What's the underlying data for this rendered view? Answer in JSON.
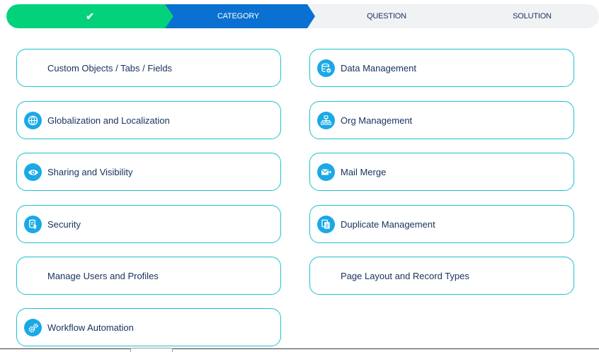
{
  "progress": {
    "completed_mark": "✔",
    "steps": [
      "CATEGORY",
      "QUESTION",
      "SOLUTION"
    ],
    "active_step": "CATEGORY",
    "colors": {
      "done": "#04d27b",
      "active": "#0a70d1",
      "pending": "#f1f2f4"
    }
  },
  "categories": [
    {
      "label": "Custom Objects / Tabs / Fields",
      "icon": ""
    },
    {
      "label": "Data Management",
      "icon": "database-check-icon"
    },
    {
      "label": "Globalization and Localization",
      "icon": "globe-icon"
    },
    {
      "label": "Org Management",
      "icon": "hierarchy-icon"
    },
    {
      "label": "Sharing and Visibility",
      "icon": "eye-icon"
    },
    {
      "label": "Mail Merge",
      "icon": "envelope-icon"
    },
    {
      "label": "Security",
      "icon": "shield-document-icon"
    },
    {
      "label": "Duplicate Management",
      "icon": "duplicate-docs-icon"
    },
    {
      "label": "Manage Users and Profiles",
      "icon": ""
    },
    {
      "label": "Page Layout and Record Types",
      "icon": ""
    },
    {
      "label": "Workflow Automation",
      "icon": "gears-icon"
    }
  ],
  "accent_colors": {
    "card_border": "#1bc3cc",
    "icon_bg": "#1aa9e6",
    "text": "#16325c"
  }
}
